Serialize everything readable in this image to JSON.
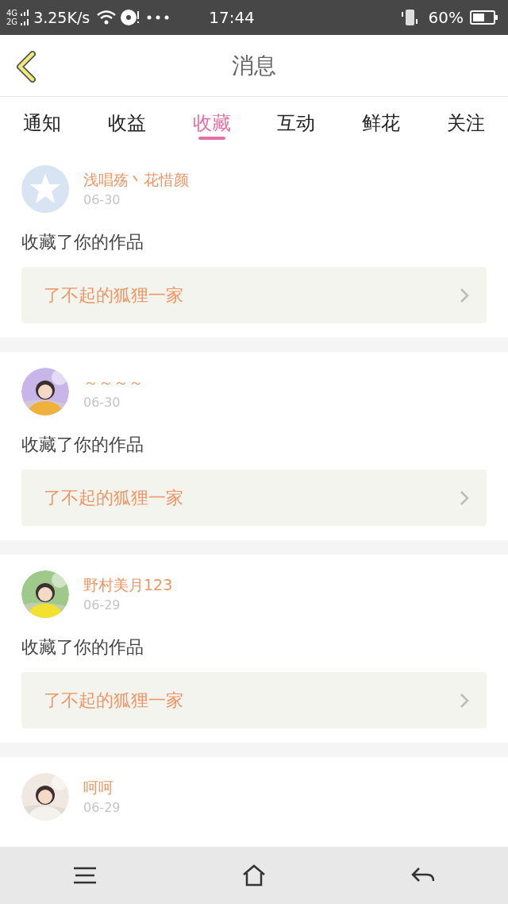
{
  "status_bar": {
    "network_top": "4G",
    "network_bottom": "2G",
    "speed": "3.25K/s",
    "time": "17:44",
    "battery": "60%"
  },
  "header": {
    "title": "消息"
  },
  "tabs": [
    {
      "label": "通知",
      "selected": false
    },
    {
      "label": "收益",
      "selected": false
    },
    {
      "label": "收藏",
      "selected": true
    },
    {
      "label": "互动",
      "selected": false
    },
    {
      "label": "鲜花",
      "selected": false
    },
    {
      "label": "关注",
      "selected": false
    }
  ],
  "messages": [
    {
      "avatar": {
        "kind": "default"
      },
      "name": "浅唱殇丶花惜颜",
      "date": "06-30",
      "action": "收藏了你的作品",
      "work": "了不起的狐狸一家"
    },
    {
      "name": "～～～～",
      "date": "06-30",
      "action": "收藏了你的作品",
      "work": "了不起的狐狸一家"
    },
    {
      "name": "野村美月123",
      "date": "06-29",
      "action": "收藏了你的作品",
      "work": "了不起的狐狸一家"
    },
    {
      "name": "呵呵",
      "date": "06-29"
    }
  ]
}
